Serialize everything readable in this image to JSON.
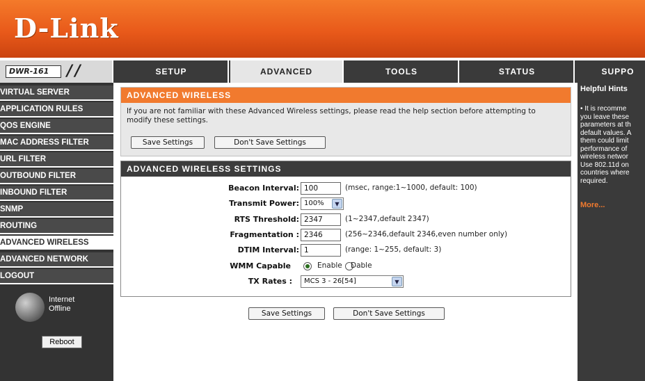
{
  "brand": {
    "logo": "D-Link"
  },
  "nav": {
    "model": "DWR-161",
    "tabs": [
      {
        "label": "SETUP"
      },
      {
        "label": "ADVANCED"
      },
      {
        "label": "TOOLS"
      },
      {
        "label": "STATUS"
      },
      {
        "label": "SUPPO"
      }
    ],
    "active_tab": "ADVANCED"
  },
  "sidebar": {
    "items": [
      {
        "label": "VIRTUAL SERVER"
      },
      {
        "label": "APPLICATION RULES"
      },
      {
        "label": "QOS ENGINE"
      },
      {
        "label": "MAC ADDRESS FILTER"
      },
      {
        "label": "URL FILTER"
      },
      {
        "label": "OUTBOUND FILTER"
      },
      {
        "label": "INBOUND FILTER"
      },
      {
        "label": "SNMP"
      },
      {
        "label": "ROUTING"
      },
      {
        "label": "ADVANCED WIRELESS"
      },
      {
        "label": "ADVANCED NETWORK"
      },
      {
        "label": "LOGOUT"
      }
    ],
    "active_item": "ADVANCED WIRELESS",
    "internet_status": "Internet",
    "internet_state": "Offline",
    "reboot_label": "Reboot"
  },
  "intro_panel": {
    "title": "ADVANCED WIRELESS",
    "description": "If you are not familiar with these Advanced Wireless settings, please read the help section before attempting to modify these settings.",
    "save_label": "Save Settings",
    "dont_save_label": "Don't Save Settings"
  },
  "settings_panel": {
    "title": "ADVANCED WIRELESS SETTINGS",
    "beacon": {
      "label": "Beacon Interval:",
      "value": "100",
      "hint": "(msec, range:1~1000, default: 100)"
    },
    "transmit": {
      "label": "Transmit Power:",
      "value": "100%"
    },
    "rts": {
      "label": "RTS Threshold:",
      "value": "2347",
      "hint": "(1~2347,default 2347)"
    },
    "frag": {
      "label": "Fragmentation :",
      "value": "2346",
      "hint": "(256~2346,default 2346,even number only)"
    },
    "dtim": {
      "label": "DTIM Interval:",
      "value": "1",
      "hint": "(range: 1~255, default: 3)"
    },
    "wmm": {
      "label": "WMM Capable",
      "enable_label": "Enable",
      "disable_label": "Dable",
      "selected": "Enable"
    },
    "tx_rates": {
      "label": "TX Rates :",
      "value": "MCS 3 - 26[54]"
    }
  },
  "bottom_buttons": {
    "save_label": "Save Settings",
    "dont_save_label": "Don't Save Settings"
  },
  "hints": {
    "title": "Helpful Hints",
    "text": "• It is recomme\nyou leave these\nparameters at th\ndefault values. A\nthem could limit\nperformance of\nwireless networ\nUse 802.11d on\ncountries where\nrequired.",
    "more": "More..."
  },
  "colors": {
    "brand_orange": "#f17a2e",
    "dark_gray": "#3a3a3a",
    "active_green": "#2a6e1e"
  }
}
